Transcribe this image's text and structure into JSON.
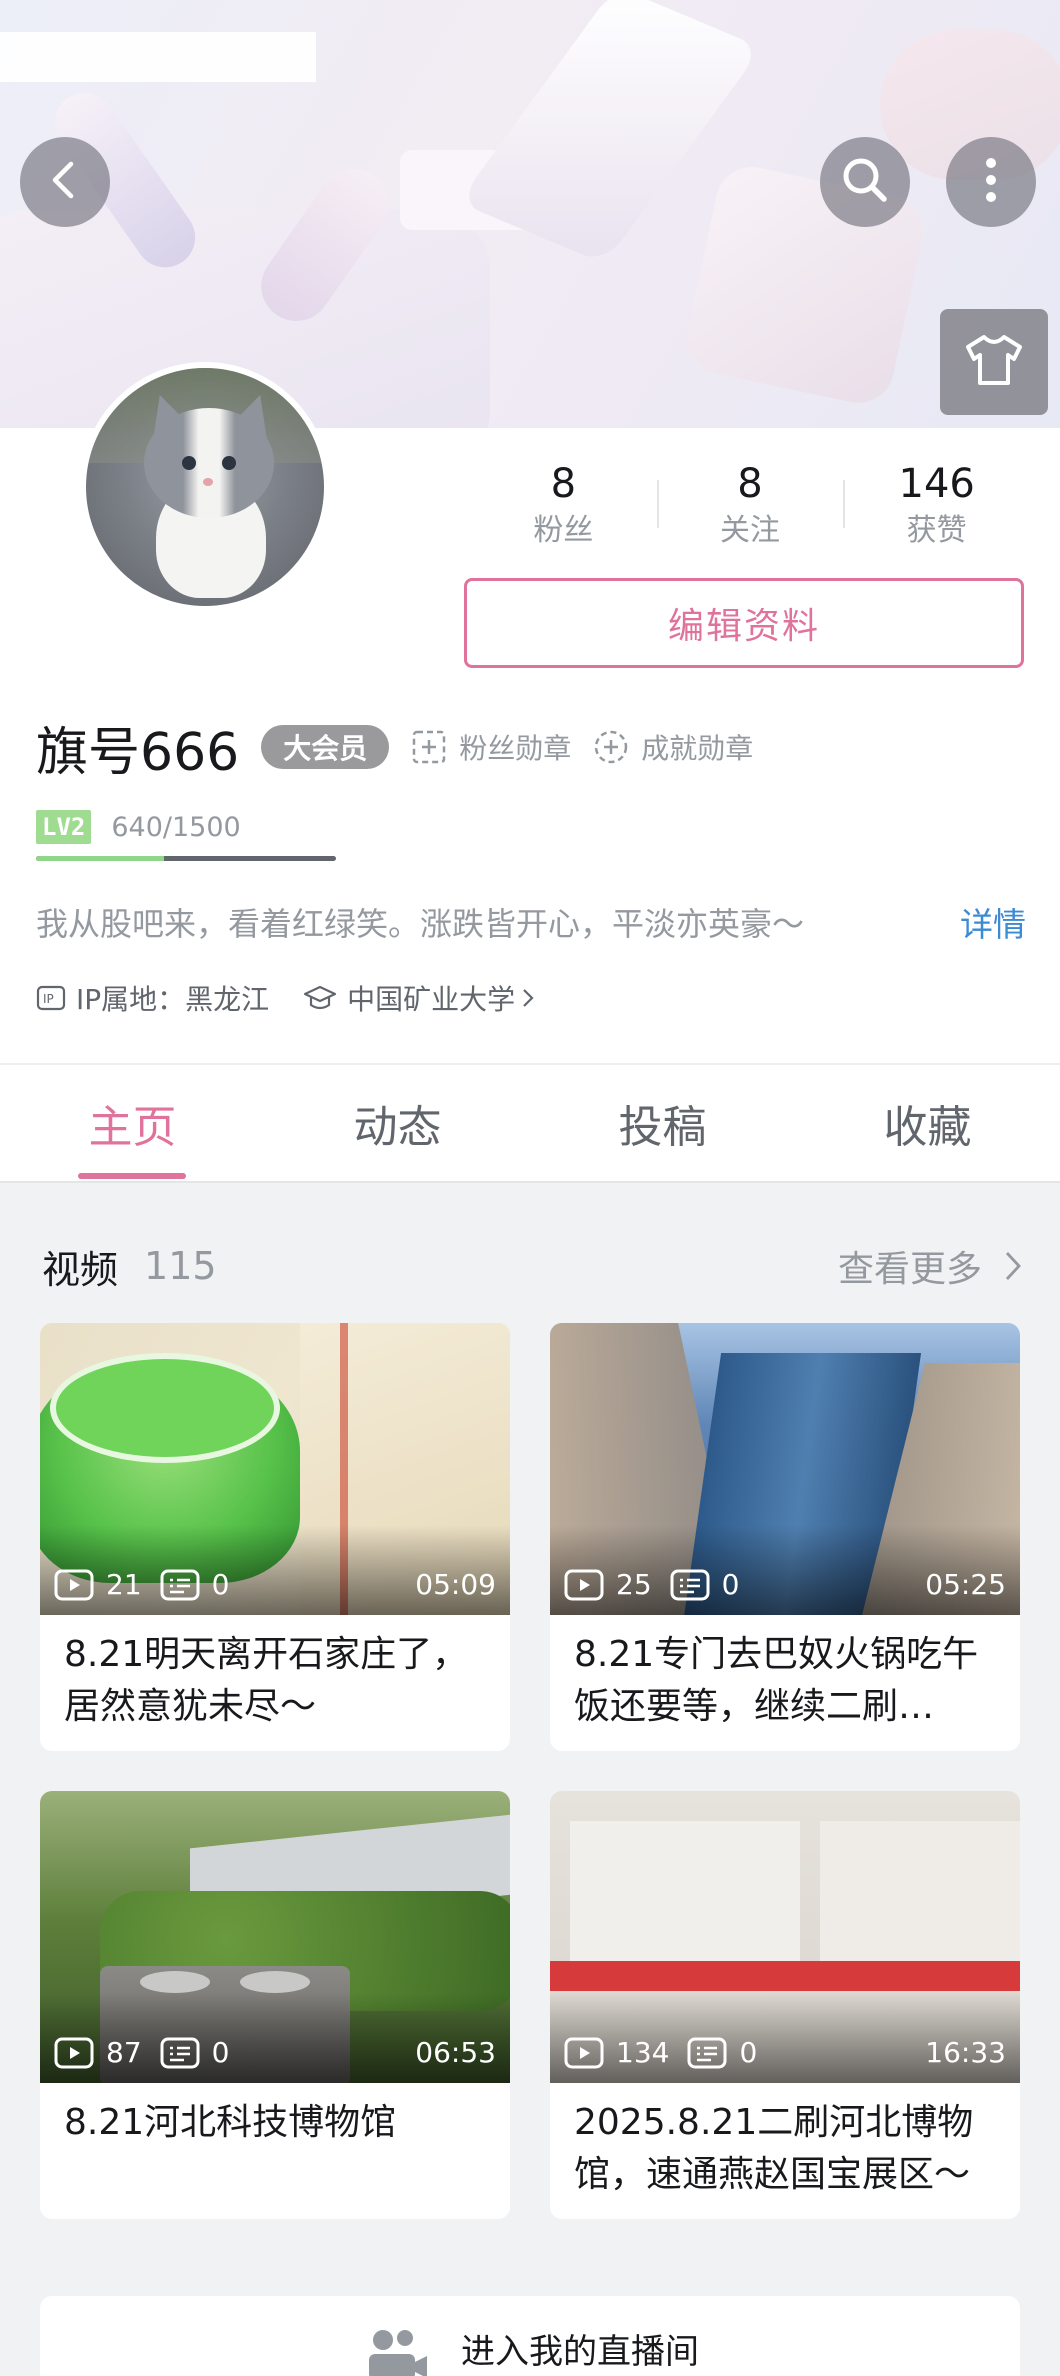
{
  "header": {
    "back_icon": "back-arrow-icon",
    "search_icon": "search-icon",
    "more_icon": "more-vertical-icon",
    "dress_icon": "tshirt-icon"
  },
  "profile": {
    "stats": [
      {
        "value": "8",
        "label": "粉丝"
      },
      {
        "value": "8",
        "label": "关注"
      },
      {
        "value": "146",
        "label": "获赞"
      }
    ],
    "edit_button": "编辑资料",
    "name": "旗号666",
    "vip_badge": "大会员",
    "fan_medal": "粉丝勋章",
    "achievement_medal": "成就勋章",
    "level": "LV2",
    "exp_text": "640/1500",
    "exp_progress": 0.427,
    "signature": "我从股吧来，看着红绿笑。涨跌皆开心，平淡亦英豪～",
    "signature_detail": "详情",
    "ip_location": "IP属地：黑龙江",
    "school": "中国矿业大学"
  },
  "tabs": [
    {
      "label": "主页",
      "active": true
    },
    {
      "label": "动态",
      "active": false
    },
    {
      "label": "投稿",
      "active": false
    },
    {
      "label": "收藏",
      "active": false
    }
  ],
  "videos": {
    "title": "视频",
    "count": "115",
    "more": "查看更多",
    "items": [
      {
        "plays": "21",
        "danmaku": "0",
        "duration": "05:09",
        "title": "8.21明天离开石家庄了，居然意犹未尽～"
      },
      {
        "plays": "25",
        "danmaku": "0",
        "duration": "05:25",
        "title": "8.21专门去巴奴火锅吃午饭还要等，继续二刷…"
      },
      {
        "plays": "87",
        "danmaku": "0",
        "duration": "06:53",
        "title": "8.21河北科技博物馆"
      },
      {
        "plays": "134",
        "danmaku": "0",
        "duration": "16:33",
        "title": "2025.8.21二刷河北博物馆，速通燕赵国宝展区～"
      }
    ]
  },
  "live": {
    "label": "进入我的直播间"
  },
  "colors": {
    "accent": "#e0739b",
    "link": "#3b8ad4",
    "level": "#9fdc91"
  }
}
